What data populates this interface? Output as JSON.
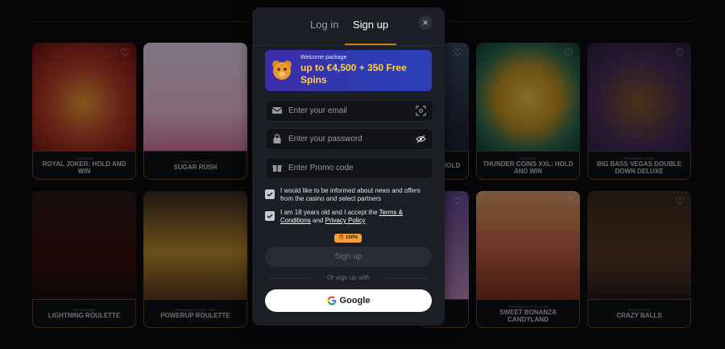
{
  "modal": {
    "tabs": [
      {
        "label": "Log in"
      },
      {
        "label": "Sign up"
      }
    ],
    "close_label": "×",
    "promo": {
      "small": "Welcome package",
      "big": "up to €4,500 + 350 Free Spins"
    },
    "email_placeholder": "Enter your email",
    "password_placeholder": "Enter your password",
    "promo_placeholder": "Enter Promo code",
    "checkbox1": "I would like to be informed about news and offers from the casino and select partners",
    "checkbox2_pre": "I am 18 years old and I accept the ",
    "terms_link": "Terms & Conditions",
    "checkbox2_mid": " and ",
    "privacy_link": "Privacy Policy",
    "badge": "🎁 150%",
    "signup_button": "Sign up",
    "or_label": "Or sign up with",
    "google_button": "Google"
  },
  "games": [
    {
      "provider": "PLAYSON",
      "title": "ROYAL JOKER: HOLD AND WIN"
    },
    {
      "provider": "PRAGMATIC PLAY",
      "title": "SUGAR RUSH"
    },
    {
      "provider": "",
      "title": "HOLD"
    },
    {
      "provider": "PLAYSON",
      "title": "THUNDER COINS XXL: HOLD AND WIN"
    },
    {
      "provider": "PRAGMATIC PLAY",
      "title": "BIG BASS VEGAS DOUBLE DOWN DELUXE"
    },
    {
      "provider": "EVOLUTION",
      "title": "LIGHTNING ROULETTE"
    },
    {
      "provider": "PRAGMATIC PLAY LIVE",
      "title": "POWERUP ROULETTE"
    },
    {
      "provider": "PRAGMATIC PLAY LIVE",
      "title": "SWEET BONANZA CANDYLAND"
    },
    {
      "provider": "EVOLUTION",
      "title": "CRAZY BALLS"
    }
  ],
  "colors": {
    "accent": "#c97a22",
    "banner": "#3d2ca8",
    "highlight": "#ffd049"
  }
}
